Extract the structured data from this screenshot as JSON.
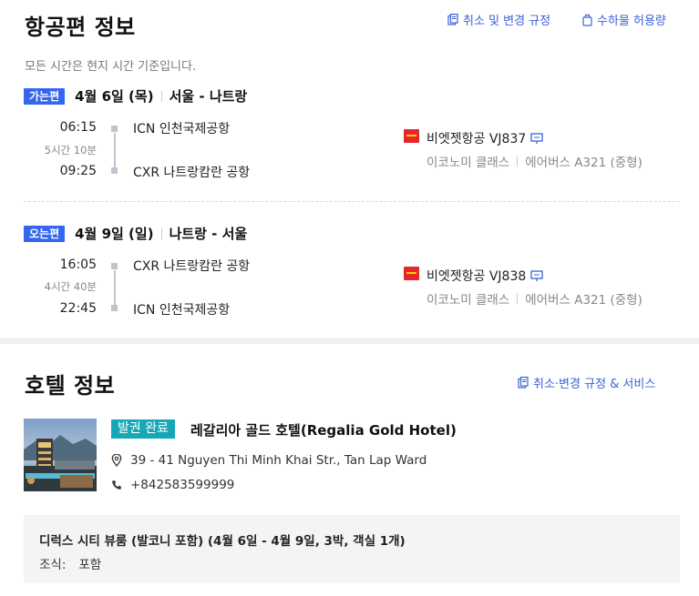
{
  "flight": {
    "title": "항공편 정보",
    "cancel_link": "취소 및 변경 규정",
    "baggage_link": "수하물 허용량",
    "note": "모든 시간은 현지 시간 기준입니다.",
    "legs": [
      {
        "badge": "가는편",
        "date": "4월 6일 (목)",
        "route": "서울 - 나트랑",
        "depart_time": "06:15",
        "duration": "5시간 10분",
        "arrive_time": "09:25",
        "depart_airport": "ICN  인천국제공항",
        "arrive_airport": "CXR  나트랑캄란 공항",
        "airline": "비엣젯항공 VJ837",
        "cabin": "이코노미 클래스",
        "aircraft": "에어버스 A321 (중형)"
      },
      {
        "badge": "오는편",
        "date": "4월 9일 (일)",
        "route": "나트랑 - 서울",
        "depart_time": "16:05",
        "duration": "4시간 40분",
        "arrive_time": "22:45",
        "depart_airport": "CXR  나트랑캄란 공항",
        "arrive_airport": "ICN  인천국제공항",
        "airline": "비엣젯항공 VJ838",
        "cabin": "이코노미 클래스",
        "aircraft": "에어버스 A321 (중형)"
      }
    ]
  },
  "hotel": {
    "title": "호텔 정보",
    "policy_link": "취소·변경 규정 & 서비스",
    "status": "발권 완료",
    "name": "레갈리아 골드 호텔(Regalia Gold Hotel)",
    "address": "39 - 41 Nguyen Thi Minh Khai Str., Tan Lap Ward",
    "phone": "+842583599999",
    "room": {
      "title": "디럭스 시티 뷰룸 (발코니 포함) (4월 6일 - 4월 9일, 3박, 객실 1개)",
      "meal_label": "조식:",
      "meal_value": "포함"
    }
  },
  "colors": {
    "accent": "#3466f0",
    "link": "#3a63d6",
    "status": "#16a8b6",
    "airline_logo": "#e5262b"
  }
}
